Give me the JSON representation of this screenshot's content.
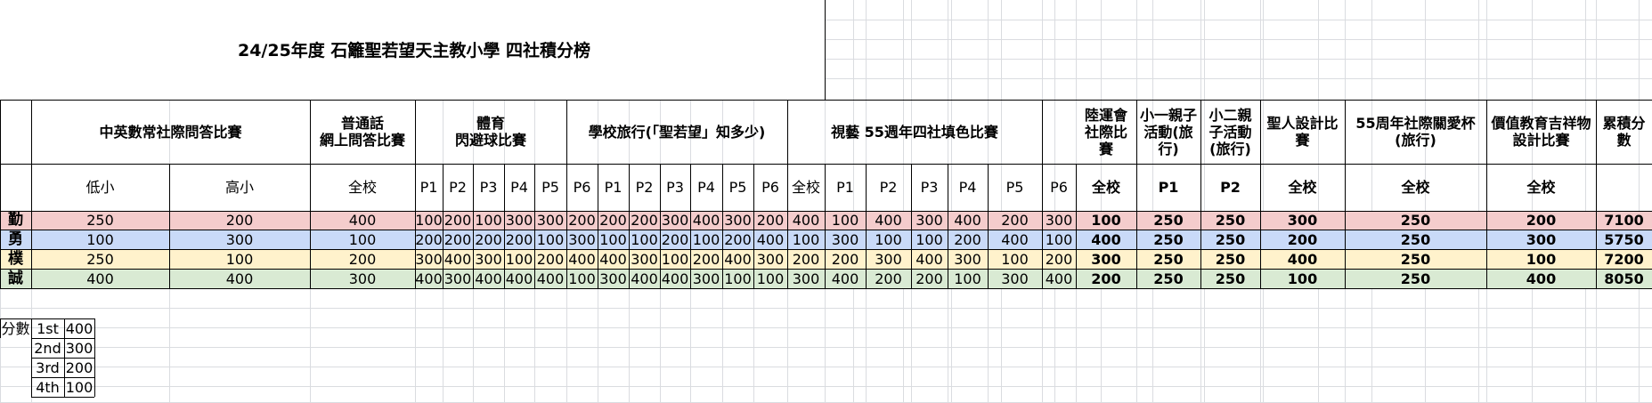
{
  "title": "24/25年度 石籬聖若望天主教小學 四社積分榜",
  "colors": {
    "row_勤": "#f4cccc",
    "row_勇": "#c9daf8",
    "row_樸": "#fff2cc",
    "row_誠": "#d9ead3",
    "gridline": "#dadce0",
    "border": "#000000"
  },
  "headers": {
    "group_names": {
      "g1": "中英數常社際問答比賽",
      "g2": "普通話\n網上問答比賽",
      "g3": "體育\n閃避球比賽",
      "g4": "學校旅行(「聖若望」知多少)",
      "g5": "視藝 55週年四社填色比賽",
      "g6": "陸運會社際比賽",
      "g7": "小一親子活動(旅行)",
      "g8": "小二親子活動(旅行)",
      "g9": "聖人設計比賽",
      "g10": "55周年社際關愛杯(旅行)",
      "g11": "價值教育吉祥物設計比賽",
      "g12": "累積分數"
    },
    "sub": [
      "低小",
      "高小",
      "全校",
      "P1",
      "P2",
      "P3",
      "P4",
      "P5",
      "P6",
      "P1",
      "P2",
      "P3",
      "P4",
      "P5",
      "P6",
      "全校",
      "P1",
      "P2",
      "P3",
      "P4",
      "P5",
      "P6",
      "全校",
      "P1",
      "P2",
      "全校",
      "全校",
      "全校"
    ]
  },
  "rows": [
    {
      "house": "勤",
      "values": [
        "250",
        "200",
        "400",
        "100",
        "200",
        "100",
        "300",
        "300",
        "200",
        "200",
        "200",
        "300",
        "400",
        "300",
        "200",
        "400",
        "100",
        "400",
        "300",
        "400",
        "200",
        "300",
        "100",
        "250",
        "250",
        "300",
        "250",
        "200",
        "7100"
      ]
    },
    {
      "house": "勇",
      "values": [
        "100",
        "300",
        "100",
        "200",
        "200",
        "200",
        "200",
        "100",
        "300",
        "100",
        "100",
        "200",
        "100",
        "200",
        "400",
        "100",
        "300",
        "100",
        "100",
        "200",
        "400",
        "100",
        "400",
        "250",
        "250",
        "200",
        "250",
        "300",
        "5750"
      ]
    },
    {
      "house": "樸",
      "values": [
        "250",
        "100",
        "200",
        "300",
        "400",
        "300",
        "100",
        "200",
        "400",
        "400",
        "300",
        "100",
        "200",
        "400",
        "300",
        "200",
        "200",
        "300",
        "400",
        "300",
        "100",
        "200",
        "300",
        "250",
        "250",
        "400",
        "250",
        "100",
        "7200"
      ]
    },
    {
      "house": "誠",
      "values": [
        "400",
        "400",
        "300",
        "400",
        "300",
        "400",
        "400",
        "400",
        "100",
        "300",
        "400",
        "400",
        "300",
        "100",
        "100",
        "300",
        "400",
        "200",
        "200",
        "100",
        "300",
        "400",
        "200",
        "250",
        "250",
        "100",
        "250",
        "400",
        "8050"
      ]
    }
  ],
  "score_table": {
    "label": "分數",
    "rows": [
      {
        "rank": "1st",
        "points": "400"
      },
      {
        "rank": "2nd",
        "points": "300"
      },
      {
        "rank": "3rd",
        "points": "200"
      },
      {
        "rank": "4th",
        "points": "100"
      }
    ]
  }
}
